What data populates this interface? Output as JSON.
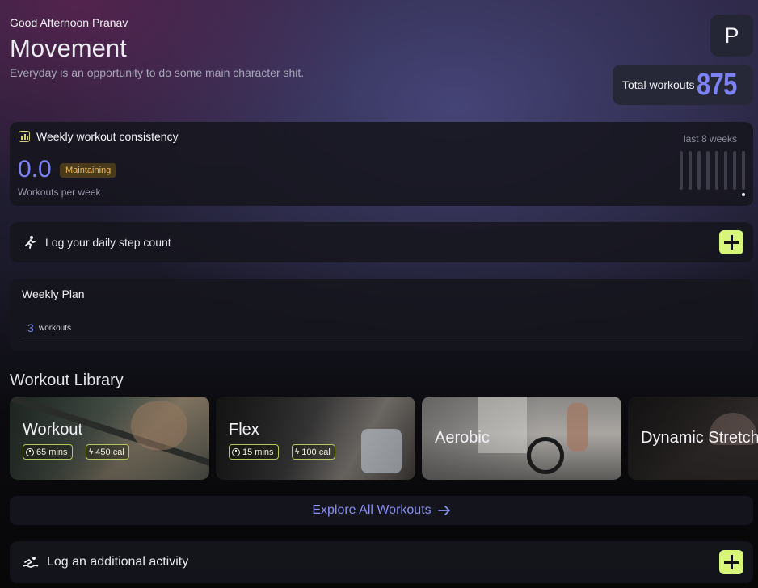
{
  "header": {
    "greeting": "Good Afternoon Pranav",
    "title": "Movement",
    "subtitle": "Everyday is an opportunity to do some main character shit.",
    "avatar_letter": "P",
    "total_workouts_label": "Total workouts",
    "total_workouts_value": "875"
  },
  "consistency": {
    "title": "Weekly workout consistency",
    "value": "0.0",
    "badge": "Maintaining",
    "unit": "Workouts per week",
    "range_label": "last 8 weeks",
    "weekly_counts": [
      0,
      0,
      0,
      0,
      0,
      0,
      0,
      0
    ]
  },
  "steps": {
    "label": "Log your daily step count"
  },
  "plan": {
    "title": "Weekly Plan",
    "count": "3",
    "count_label": "workouts"
  },
  "library": {
    "title": "Workout Library",
    "tiles": [
      {
        "name": "Workout",
        "duration": "65 mins",
        "calories": "450 cal"
      },
      {
        "name": "Flex",
        "duration": "15 mins",
        "calories": "100 cal"
      },
      {
        "name": "Aerobic"
      },
      {
        "name": "Dynamic Stretch"
      }
    ],
    "explore_label": "Explore All Workouts"
  },
  "activity": {
    "label": "Log an additional activity"
  },
  "colors": {
    "accent": "#7d82f2",
    "lime": "#d7f57a",
    "badge_text": "#f2bb5c"
  }
}
